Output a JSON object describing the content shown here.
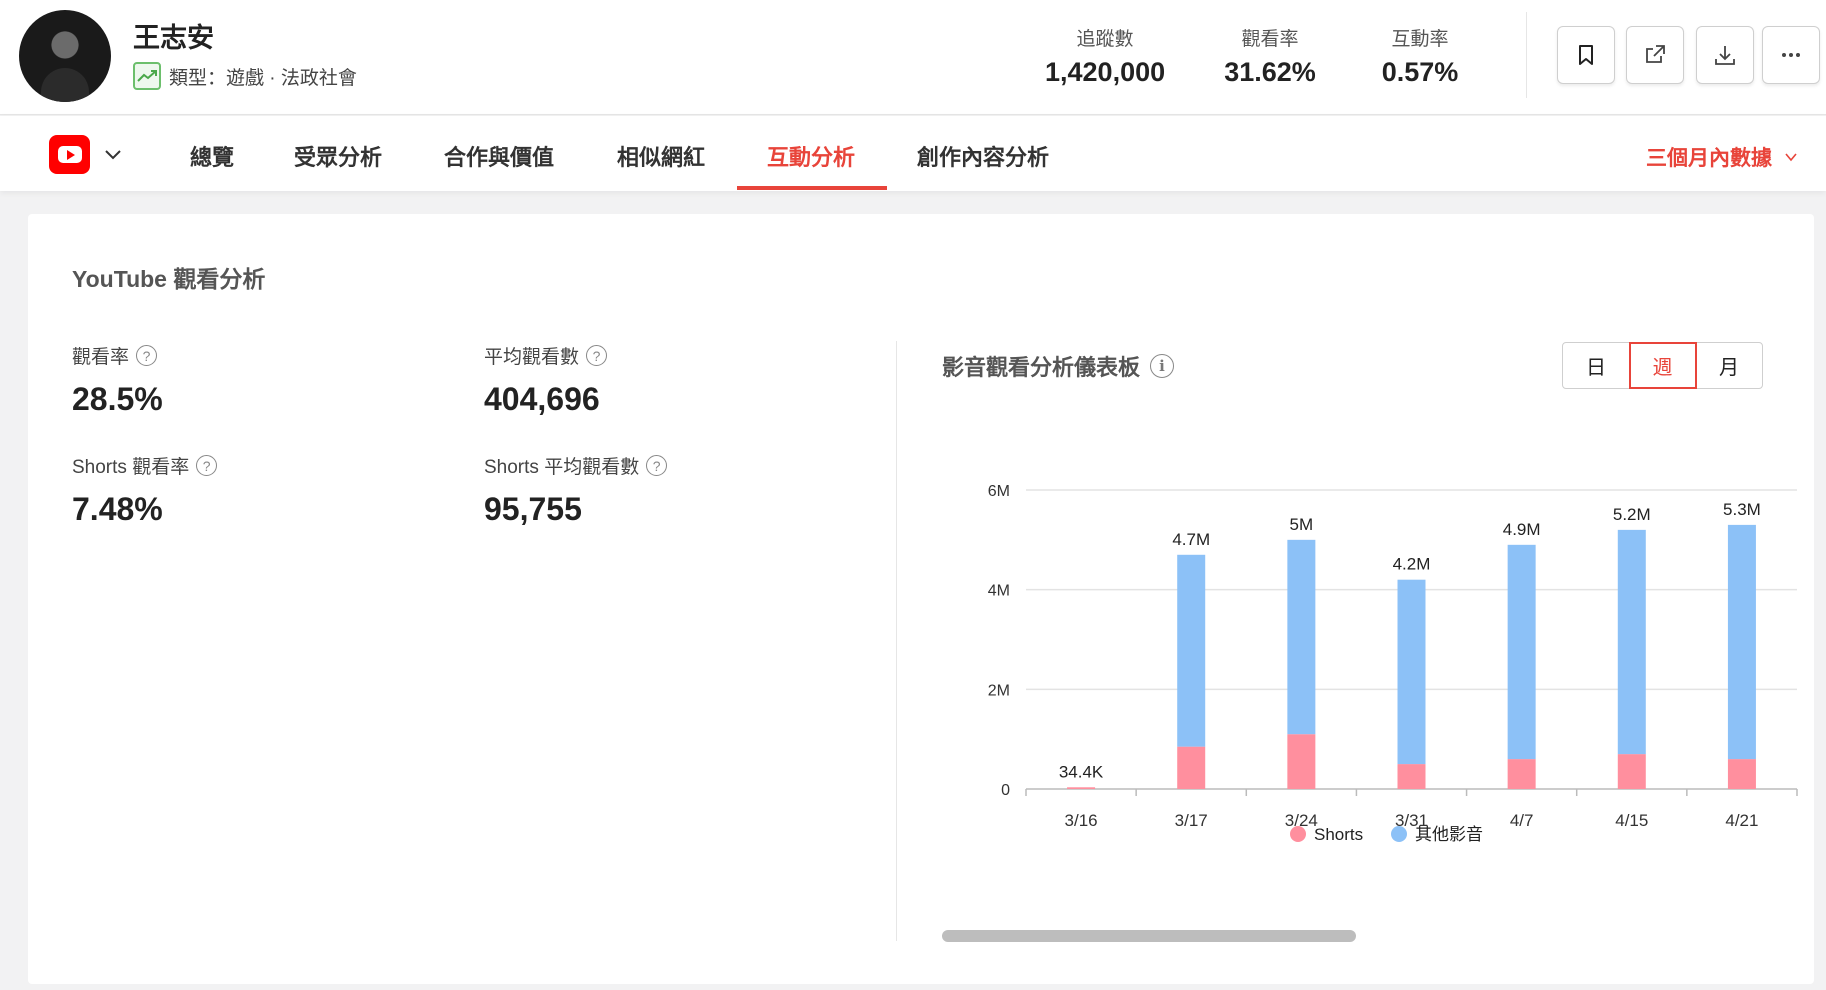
{
  "profile": {
    "name": "王志安",
    "category": "類型：遊戲 · 法政社會"
  },
  "header_stats": [
    {
      "label": "追蹤數",
      "value": "1,420,000"
    },
    {
      "label": "觀看率",
      "value": "31.62%"
    },
    {
      "label": "互動率",
      "value": "0.57%"
    }
  ],
  "toolbar": {
    "icons": [
      "bookmark-icon",
      "share-icon",
      "download-icon",
      "more-icon"
    ]
  },
  "nav": {
    "platform_icon": "youtube-icon",
    "tabs": [
      "總覽",
      "受眾分析",
      "合作與價值",
      "相似網紅",
      "互動分析",
      "創作內容分析"
    ],
    "active_tab": "互動分析",
    "range_label": "三個月內數據"
  },
  "card": {
    "title": "YouTube 觀看分析",
    "metrics": [
      {
        "label": "觀看率",
        "value": "28.5%"
      },
      {
        "label": "平均觀看數",
        "value": "404,696"
      },
      {
        "label": "Shorts 觀看率",
        "value": "7.48%"
      },
      {
        "label": "Shorts 平均觀看數",
        "value": "95,755"
      }
    ],
    "help_glyph": "?",
    "info_glyph": "i",
    "chart_title": "影音觀看分析儀表板",
    "granularity": [
      "日",
      "週",
      "月"
    ],
    "granularity_selected": "週"
  },
  "colors": {
    "accent": "#e8443a",
    "shorts": "#ff8f9e",
    "other": "#8cc1f7"
  },
  "chart_data": {
    "type": "bar",
    "stacked": true,
    "categories": [
      "3/16",
      "3/17",
      "3/24",
      "3/31",
      "4/7",
      "4/15",
      "4/21"
    ],
    "series": [
      {
        "name": "Shorts",
        "values": [
          0.0344,
          0.85,
          1.1,
          0.5,
          0.6,
          0.7,
          0.6
        ]
      },
      {
        "name": "其他影音",
        "values": [
          0,
          3.85,
          3.9,
          3.7,
          4.3,
          4.5,
          4.7
        ]
      }
    ],
    "totals_labels": [
      "34.4K",
      "4.7M",
      "5M",
      "4.2M",
      "4.9M",
      "5.2M",
      "5.3M"
    ],
    "y_ticks": [
      "0",
      "2M",
      "4M",
      "6M"
    ],
    "y_tick_values": [
      0,
      2,
      4,
      6
    ],
    "ylim": [
      0,
      6
    ],
    "unit": "M",
    "grid": true,
    "legend_position": "bottom"
  }
}
